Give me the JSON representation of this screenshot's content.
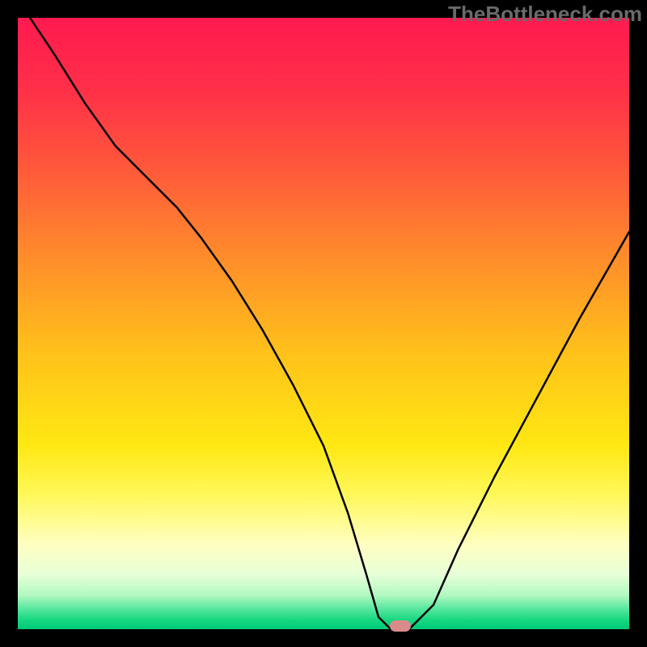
{
  "watermark": "TheBottleneck.com",
  "chart_data": {
    "type": "line",
    "title": "",
    "xlabel": "",
    "ylabel": "",
    "xlim": [
      0,
      100
    ],
    "ylim": [
      0,
      100
    ],
    "grid": false,
    "legend": false,
    "background_gradient": {
      "stops": [
        {
          "pos": 0.0,
          "color": "#ff1a50"
        },
        {
          "pos": 0.12,
          "color": "#ff3048"
        },
        {
          "pos": 0.25,
          "color": "#ff5a3a"
        },
        {
          "pos": 0.4,
          "color": "#ff8f2a"
        },
        {
          "pos": 0.55,
          "color": "#ffc21a"
        },
        {
          "pos": 0.7,
          "color": "#ffe813"
        },
        {
          "pos": 0.78,
          "color": "#fff85a"
        },
        {
          "pos": 0.86,
          "color": "#ffffc0"
        },
        {
          "pos": 0.91,
          "color": "#e8ffd8"
        },
        {
          "pos": 0.945,
          "color": "#b0f8c0"
        },
        {
          "pos": 0.965,
          "color": "#5de8a0"
        },
        {
          "pos": 0.985,
          "color": "#16d880"
        },
        {
          "pos": 1.0,
          "color": "#00c878"
        }
      ]
    },
    "series": [
      {
        "name": "bottleneck-curve",
        "x": [
          2,
          6,
          11,
          16,
          21,
          26,
          30,
          35,
          40,
          45,
          50,
          54,
          57,
          59,
          61,
          64,
          68,
          72,
          78,
          85,
          92,
          100
        ],
        "y": [
          100,
          94,
          86,
          79,
          74,
          69,
          64,
          57,
          49,
          40,
          30,
          19,
          9,
          2,
          0,
          0,
          4,
          13,
          25,
          38,
          51,
          65
        ]
      }
    ],
    "marker": {
      "x": 62.5,
      "y": 0.5,
      "color": "#d98b8b"
    }
  }
}
